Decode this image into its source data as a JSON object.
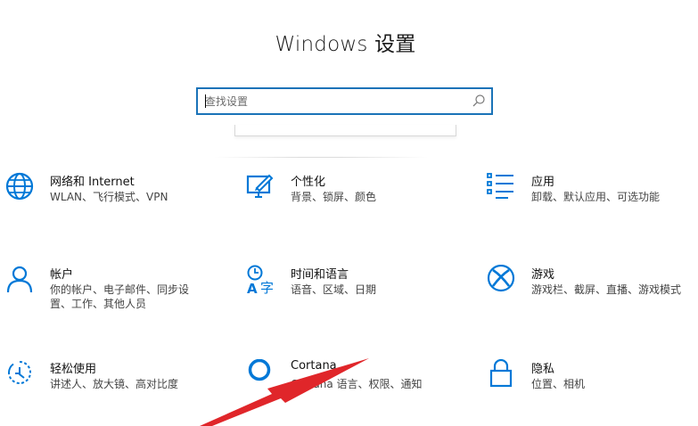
{
  "window": {
    "title": "Windows 设置"
  },
  "search": {
    "placeholder": "查找设置"
  },
  "colors": {
    "accent": "#0078d7",
    "search_border": "#1a73b8",
    "annotation_arrow": "#e0262a"
  },
  "tiles": [
    {
      "name": "网络和 Internet",
      "desc_lines": [
        "WLAN、飞行模式、VPN"
      ],
      "icon": "globe-icon"
    },
    {
      "name": "个性化",
      "desc_lines": [
        "背景、锁屏、颜色"
      ],
      "icon": "personalization-icon"
    },
    {
      "name": "应用",
      "desc_lines": [
        "卸载、默认应用、可选功能"
      ],
      "icon": "apps-list-icon"
    },
    {
      "name": "帐户",
      "desc_lines": [
        "你的帐户、电子邮件、同步设",
        "置、工作、其他人员"
      ],
      "icon": "person-icon"
    },
    {
      "name": "时间和语言",
      "desc_lines": [
        "语音、区域、日期"
      ],
      "icon": "time-language-icon"
    },
    {
      "name": "游戏",
      "desc_lines": [
        "游戏栏、截屏、直播、游戏模式"
      ],
      "icon": "xbox-icon"
    },
    {
      "name": "轻松使用",
      "desc_lines": [
        "讲述人、放大镜、高对比度"
      ],
      "icon": "ease-of-access-icon"
    },
    {
      "name": "Cortana",
      "desc_lines": [
        "Cortana 语言、权限、通知"
      ],
      "icon": "cortana-icon"
    },
    {
      "name": "隐私",
      "desc_lines": [
        "位置、相机"
      ],
      "icon": "lock-icon"
    }
  ]
}
